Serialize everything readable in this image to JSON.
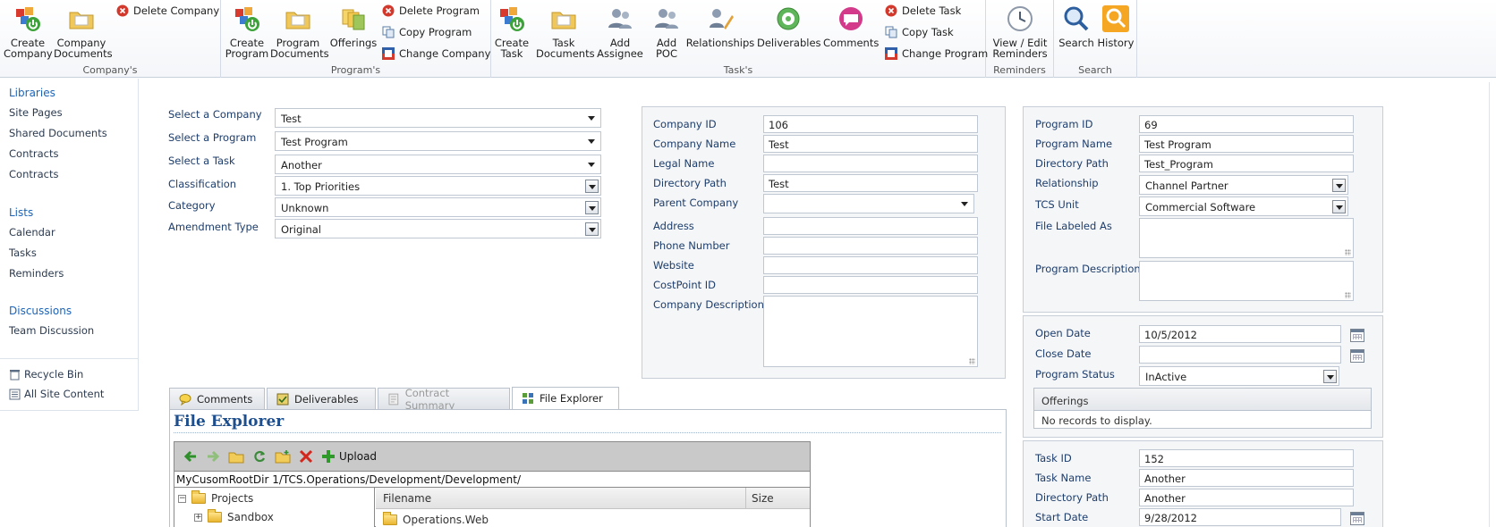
{
  "ribbon": {
    "company": {
      "label": "Company's",
      "create": "Create\nCompany",
      "documents": "Company\nDocuments",
      "delete": "Delete Company"
    },
    "program": {
      "label": "Program's",
      "create": "Create\nProgram",
      "documents": "Program\nDocuments",
      "offerings": "Offerings",
      "delete": "Delete Program",
      "copy": "Copy Program",
      "change_company": "Change Company"
    },
    "task": {
      "label": "Task's",
      "create": "Create\nTask",
      "documents": "Task\nDocuments",
      "add_assignee": "Add\nAssignee",
      "add_poc": "Add\nPOC",
      "relationships": "Relationships",
      "deliverables": "Deliverables",
      "comments": "Comments",
      "delete": "Delete Task",
      "copy": "Copy Task",
      "change_program": "Change Program"
    },
    "reminders": {
      "label": "Reminders",
      "view_edit": "View / Edit\nReminders"
    },
    "search": {
      "label": "Search",
      "search": "Search",
      "history": "History"
    }
  },
  "nav": {
    "libraries": "Libraries",
    "site_pages": "Site Pages",
    "shared_documents": "Shared Documents",
    "contracts1": "Contracts",
    "contracts2": "Contracts",
    "lists": "Lists",
    "calendar": "Calendar",
    "tasks": "Tasks",
    "reminders": "Reminders",
    "discussions": "Discussions",
    "team_discussion": "Team Discussion",
    "recycle_bin": "Recycle Bin",
    "all_site_content": "All Site Content"
  },
  "selectors": {
    "company_label": "Select a Company",
    "company_value": "Test",
    "program_label": "Select a Program",
    "program_value": "Test Program",
    "task_label": "Select a Task",
    "task_value": "Another",
    "classification_label": "Classification",
    "classification_value": "1. Top Priorities",
    "category_label": "Category",
    "category_value": "Unknown",
    "amendment_label": "Amendment Type",
    "amendment_value": "Original"
  },
  "company": {
    "id_label": "Company ID",
    "id_value": "106",
    "name_label": "Company Name",
    "name_value": "Test",
    "legal_label": "Legal Name",
    "legal_value": "",
    "dir_label": "Directory Path",
    "dir_value": "Test",
    "parent_label": "Parent Company",
    "parent_value": "",
    "address_label": "Address",
    "address_value": "",
    "phone_label": "Phone Number",
    "phone_value": "",
    "website_label": "Website",
    "website_value": "",
    "costpoint_label": "CostPoint ID",
    "costpoint_value": "",
    "desc_label": "Company Description"
  },
  "program": {
    "id_label": "Program ID",
    "id_value": "69",
    "name_label": "Program Name",
    "name_value": "Test Program",
    "dir_label": "Directory Path",
    "dir_value": "Test_Program",
    "rel_label": "Relationship",
    "rel_value": "Channel Partner",
    "unit_label": "TCS Unit",
    "unit_value": "Commercial Software",
    "file_label": "File Labeled As",
    "desc_label": "Program Description",
    "open_label": "Open Date",
    "open_value": "10/5/2012",
    "close_label": "Close Date",
    "close_value": "",
    "status_label": "Program Status",
    "status_value": "InActive",
    "offerings_header": "Offerings",
    "offerings_empty": "No records to display."
  },
  "task": {
    "id_label": "Task ID",
    "id_value": "152",
    "name_label": "Task Name",
    "name_value": "Another",
    "dir_label": "Directory Path",
    "dir_value": "Another",
    "start_label": "Start Date",
    "start_value": "9/28/2012"
  },
  "tabs": {
    "comments": "Comments",
    "deliverables": "Deliverables",
    "contract_summary": "Contract Summary",
    "file_explorer": "File Explorer"
  },
  "file_explorer": {
    "title": "File Explorer",
    "upload": "Upload",
    "path": "MyCusomRootDir 1/TCS.Operations/Development/Development/",
    "tree_root": "Projects",
    "tree_child": "Sandbox",
    "col_filename": "Filename",
    "col_size": "Size",
    "row1": "Operations.Web"
  }
}
